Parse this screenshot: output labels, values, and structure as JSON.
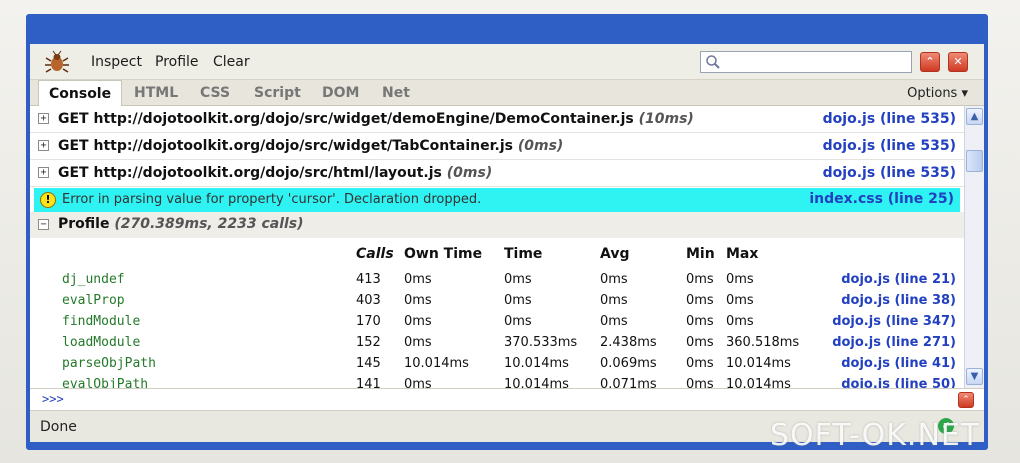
{
  "toolbar": {
    "logo_icon": "firebug-icon",
    "inspect_label": "Inspect",
    "profile_label": "Profile",
    "clear_label": "Clear",
    "search_placeholder": "",
    "search_icon": "search-icon"
  },
  "tabs": [
    {
      "label": "Console",
      "active": true
    },
    {
      "label": "HTML"
    },
    {
      "label": "CSS"
    },
    {
      "label": "Script"
    },
    {
      "label": "DOM"
    },
    {
      "label": "Net"
    }
  ],
  "options_label": "Options ▾",
  "requests": [
    {
      "method_url": "GET http://dojotoolkit.org/dojo/src/widget/demoEngine/DemoContainer.js",
      "time": "(10ms)",
      "source": "dojo.js (line 535)"
    },
    {
      "method_url": "GET http://dojotoolkit.org/dojo/src/widget/TabContainer.js",
      "time": "(0ms)",
      "source": "dojo.js (line 535)"
    },
    {
      "method_url": "GET http://dojotoolkit.org/dojo/src/html/layout.js",
      "time": "(0ms)",
      "source": "dojo.js (line 535)"
    }
  ],
  "error": {
    "message": "Error in parsing value for property 'cursor'. Declaration dropped.",
    "source": "index.css (line 25)",
    "highlight_color": "#2ff2f2"
  },
  "profile": {
    "title": "Profile",
    "stats": "(270.389ms, 2233 calls)",
    "columns": [
      "Calls",
      "Own Time",
      "Time",
      "Avg",
      "Min",
      "Max"
    ],
    "rows": [
      {
        "name": "dj_undef",
        "calls": "413",
        "own": "0ms",
        "time": "0ms",
        "avg": "0ms",
        "min": "0ms",
        "max": "0ms",
        "source": "dojo.js (line 21)"
      },
      {
        "name": "evalProp",
        "calls": "403",
        "own": "0ms",
        "time": "0ms",
        "avg": "0ms",
        "min": "0ms",
        "max": "0ms",
        "source": "dojo.js (line 38)"
      },
      {
        "name": "findModule",
        "calls": "170",
        "own": "0ms",
        "time": "0ms",
        "avg": "0ms",
        "min": "0ms",
        "max": "0ms",
        "source": "dojo.js (line 347)"
      },
      {
        "name": "loadModule",
        "calls": "152",
        "own": "0ms",
        "time": "370.533ms",
        "avg": "2.438ms",
        "min": "0ms",
        "max": "360.518ms",
        "source": "dojo.js (line 271)"
      },
      {
        "name": "parseObjPath",
        "calls": "145",
        "own": "10.014ms",
        "time": "10.014ms",
        "avg": "0.069ms",
        "min": "0ms",
        "max": "10.014ms",
        "source": "dojo.js (line 41)"
      },
      {
        "name": "evalObjPath",
        "calls": "141",
        "own": "0ms",
        "time": "10.014ms",
        "avg": "0.071ms",
        "min": "0ms",
        "max": "10.014ms",
        "source": "dojo.js (line 50)"
      }
    ]
  },
  "command": {
    "prompt": ">>>",
    "value": ""
  },
  "status": {
    "text": "Done",
    "icon": "check-icon"
  },
  "watermark": "SOFT-OK.NET"
}
